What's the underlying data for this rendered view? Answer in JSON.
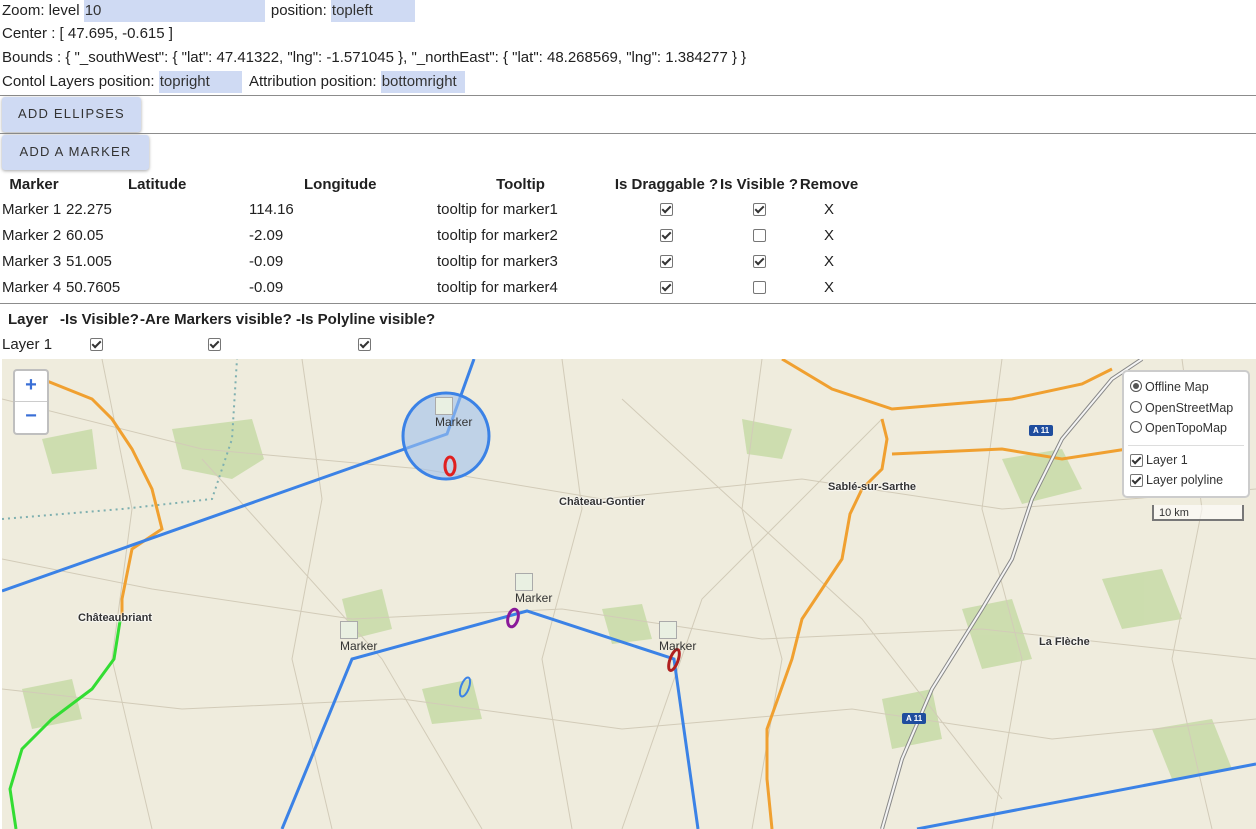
{
  "zoom": {
    "label": "Zoom: level",
    "value": "10",
    "position_label": "position:",
    "position_value": "topleft"
  },
  "center": {
    "text": "Center : [ 47.695, -0.615 ]"
  },
  "bounds": {
    "text": "Bounds : { \"_southWest\": { \"lat\": 47.41322, \"lng\": -1.571045 }, \"_northEast\": { \"lat\": 48.268569, \"lng\": 1.384277 } }"
  },
  "controls": {
    "layers_label": "Contol Layers position:",
    "layers_value": "topright",
    "attribution_label": "Attribution position:",
    "attribution_value": "bottomright"
  },
  "buttons": {
    "add_ellipses": "ADD ELLIPSES",
    "add_marker": "ADD A MARKER"
  },
  "marker_table": {
    "headers": [
      "Marker",
      "Latitude",
      "Longitude",
      "Tooltip",
      "Is Draggable ?",
      "Is Visible ?",
      "Remove"
    ],
    "rows": [
      {
        "name": "Marker 1",
        "lat": "22.275",
        "lng": "114.16",
        "tooltip": "tooltip for marker1",
        "draggable": true,
        "visible": true,
        "remove": "X"
      },
      {
        "name": "Marker 2",
        "lat": "60.05",
        "lng": "-2.09",
        "tooltip": "tooltip for marker2",
        "draggable": true,
        "visible": false,
        "remove": "X"
      },
      {
        "name": "Marker 3",
        "lat": "51.005",
        "lng": "-0.09",
        "tooltip": "tooltip for marker3",
        "draggable": true,
        "visible": true,
        "remove": "X"
      },
      {
        "name": "Marker 4",
        "lat": "50.7605",
        "lng": "-0.09",
        "tooltip": "tooltip for marker4",
        "draggable": true,
        "visible": false,
        "remove": "X"
      }
    ]
  },
  "layer_table": {
    "headers": [
      "Layer",
      "-Is Visible?",
      "-Are Markers visible?",
      "-Is Polyline visible?"
    ],
    "rows": [
      {
        "name": "Layer 1",
        "visible": true,
        "markers_visible": true,
        "polyline_visible": true
      }
    ]
  },
  "map": {
    "zoom_in": "+",
    "zoom_out": "−",
    "layer_control": {
      "base_layers": [
        {
          "label": "Offline Map",
          "selected": true
        },
        {
          "label": "OpenStreetMap",
          "selected": false
        },
        {
          "label": "OpenTopoMap",
          "selected": false
        }
      ],
      "overlays": [
        {
          "label": "Layer 1",
          "checked": true
        },
        {
          "label": "Layer polyline",
          "checked": true
        }
      ]
    },
    "scale": "10 km",
    "marker_label": "Marker",
    "cities": [
      "Château-Gontier",
      "Sablé-sur-Sarthe",
      "Châteaubriant",
      "La Flèche"
    ],
    "road_shields": [
      "A 11",
      "A 11"
    ],
    "colors": {
      "polyline": "#3b82e6",
      "circle_fill": "#9fc2ef",
      "highway": "#f0a030",
      "green_route": "#33dd33"
    }
  }
}
